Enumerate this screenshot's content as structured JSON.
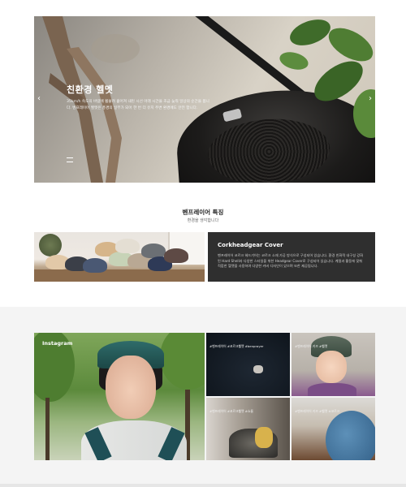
{
  "hero": {
    "title": "친환경 헬멧",
    "description": "35km/h 속도의 바람에 휩쓸려 흩어져 내린 시선 아래 시간을 조금 늦춰 일상의 순간을 봅니다. 벤프레이어 헬멧은 풍경의 일부가 되어 한 번 더 유지 주변 환경에도 안전 합니다.",
    "prev_label": "‹",
    "next_label": "›"
  },
  "features": {
    "title": "벤프레이어 특징",
    "subtitle": "환경을 생각합니다"
  },
  "feature_card": {
    "title": "Corkheadgear Cover",
    "description": "벤프레이어 코르크 헤드기어는 코르크 소재 가공 방식으로 구성되어 있습니다. 환경 친화적 내구성 강화된 Hard Shell과 다양한 스타일을 위한 Headgear Cover로 구성되어 있습니다. 계절과 활동에 맞춰 적합한 헬멧을 사용하여 다양한 커버 디자인이 있으며 또한 제공됩니다."
  },
  "instagram": {
    "label": "Instagram",
    "tiles": [
      {
        "caption": "#벤프레이어 #코르크헬멧 #benprayer"
      },
      {
        "caption": "#벤프레이어 키즈 #헬멧"
      },
      {
        "caption": "#벤프레이어 #코르크헬멧 #쇼룸"
      },
      {
        "caption": "#벤프레이어 키즈 #헬멧 #코르크"
      }
    ]
  },
  "colors": {
    "dark_card": "#2f2f2f",
    "instagram_bg": "#f4f4f4"
  }
}
